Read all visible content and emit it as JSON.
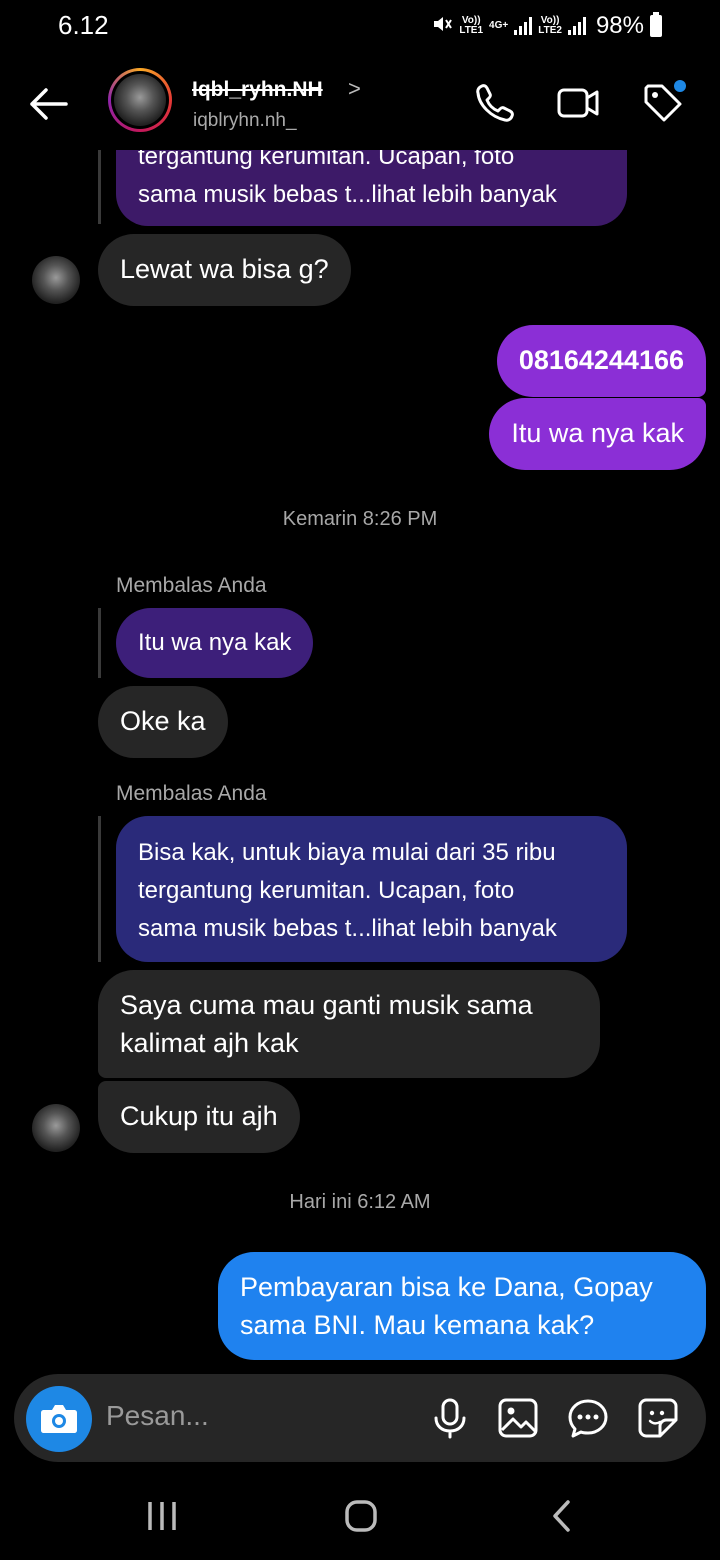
{
  "status_bar": {
    "time": "6.12",
    "sim1_top": "Vo))",
    "sim1_bottom": "LTE1",
    "network": "4G+",
    "sim2_top": "Vo))",
    "sim2_bottom": "LTE2",
    "battery": "98%"
  },
  "header": {
    "username": "Iqbl_ryhn.NH",
    "username_chevron": ">",
    "handle": "iqblryhn.nh_",
    "icons": [
      "back-arrow-icon",
      "phone-icon",
      "video-camera-icon",
      "tag-icon"
    ]
  },
  "messages": {
    "top_partial_line1": "tergantung kerumitan. Ucapan, foto",
    "top_partial_line2": "sama musik bebas t...lihat lebih banyak",
    "m1": "Lewat wa bisa g?",
    "m2": "08164244166",
    "m3": "Itu wa nya kak",
    "ts1": "Kemarin 8:26 PM",
    "reply1_label": "Membalas Anda",
    "reply1_quote": "Itu wa nya kak",
    "m4": "Oke ka",
    "reply2_label": "Membalas Anda",
    "reply2_line1": "Bisa kak, untuk biaya mulai dari 35 ribu",
    "reply2_line2": "tergantung kerumitan. Ucapan, foto",
    "reply2_line3": "sama musik bebas t...lihat lebih banyak",
    "m5_line1": "Saya cuma mau ganti musik sama",
    "m5_line2": "kalimat ajh kak",
    "m6": "Cukup itu ajh",
    "ts2": "Hari ini 6:12 AM",
    "m7_line1": "Pembayaran bisa ke Dana, Gopay",
    "m7_line2": "sama BNI. Mau kemana kak?"
  },
  "composer": {
    "placeholder": "Pesan..."
  },
  "colors": {
    "outgoing_purple": "#8b2fd6",
    "outgoing_blue": "#1f82ef",
    "incoming": "#262626",
    "reply_quote_purple": "#3d1f7a",
    "reply_quote_blue": "#2a2a7a",
    "accent": "#1e88e5"
  }
}
